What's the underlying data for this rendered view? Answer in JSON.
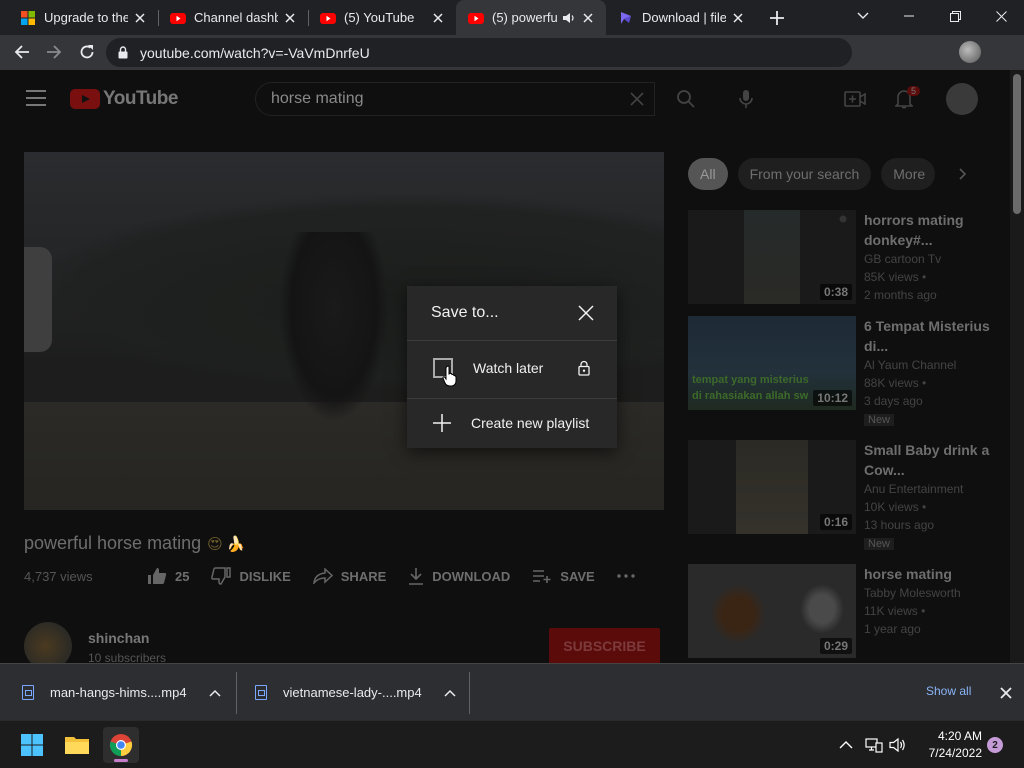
{
  "browser": {
    "tabs": [
      {
        "title": "Upgrade to the W",
        "favicon": "windows-icon"
      },
      {
        "title": "Channel dashboard",
        "favicon": "youtube-icon"
      },
      {
        "title": "(5) YouTube",
        "favicon": "youtube-icon"
      },
      {
        "title": "(5) powerful",
        "favicon": "youtube-icon",
        "active": true,
        "audio": true
      },
      {
        "title": "Download | file.io",
        "favicon": "fileio-icon"
      }
    ],
    "url": "youtube.com/watch?v=-VaVmDnrfeU"
  },
  "youtube": {
    "logo_text": "YouTube",
    "search_query": "horse mating",
    "notification_count": "5",
    "video": {
      "title": "powerful horse mating",
      "title_emoji": "😍 🍌",
      "views": "4,737 views",
      "likes": "25",
      "dislike_label": "DISLIKE",
      "share_label": "SHARE",
      "download_label": "DOWNLOAD",
      "save_label": "SAVE",
      "channel_name": "shinchan",
      "subscribers": "10 subscribers",
      "subscribe_label": "SUBSCRIBE"
    },
    "chips": [
      "All",
      "From your search",
      "More"
    ],
    "recommendations": [
      {
        "title": "horrors mating donkey#...",
        "channel": "GB cartoon Tv",
        "views": "85K views •",
        "age": "2 months ago",
        "duration": "0:38",
        "new": ""
      },
      {
        "title": "6 Tempat Misterius di...",
        "channel": "Al Yaum Channel",
        "views": "88K views •",
        "age": "3 days ago",
        "duration": "10:12",
        "new": "New",
        "thumb_text_1": "tempat yang misterius",
        "thumb_text_2": "di rahasiakan allah sw"
      },
      {
        "title": "Small Baby drink a Cow...",
        "channel": "Anu Entertainment",
        "views": "10K views •",
        "age": "13 hours ago",
        "duration": "0:16",
        "new": "New"
      },
      {
        "title": "horse mating",
        "channel": "Tabby Molesworth",
        "views": "11K views •",
        "age": "1 year ago",
        "duration": "0:29",
        "new": ""
      }
    ]
  },
  "dialog": {
    "title": "Save to...",
    "watch_later": "Watch later",
    "create_playlist": "Create new playlist"
  },
  "downloads": {
    "items": [
      {
        "name": "man-hangs-hims....mp4"
      },
      {
        "name": "vietnamese-lady-....mp4"
      }
    ],
    "show_all": "Show all"
  },
  "taskbar": {
    "time": "4:20 AM",
    "date": "7/24/2022",
    "notifications": "2"
  },
  "colors": {
    "youtube_red": "#ff0000",
    "browser_frame": "#202124",
    "toolbar": "#35363a",
    "link_blue": "#8ab4f8"
  }
}
